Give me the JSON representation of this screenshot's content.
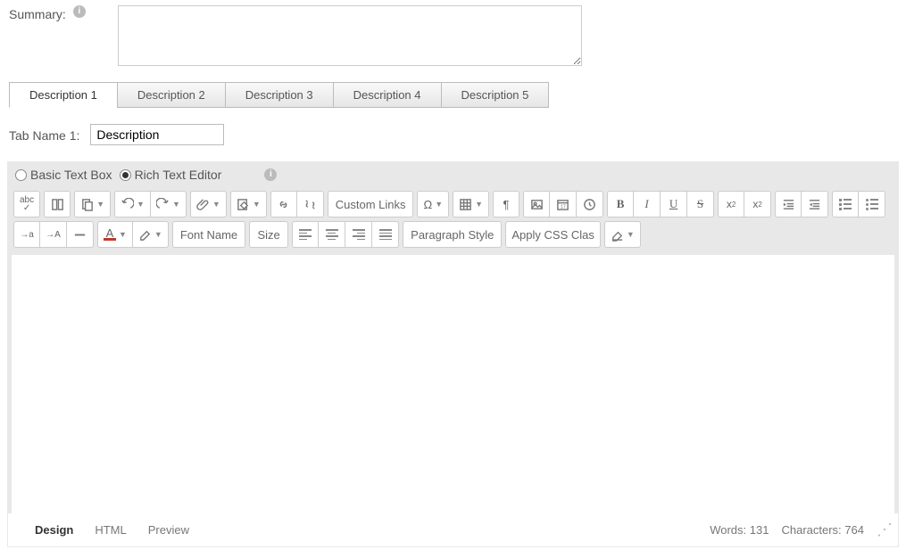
{
  "summary": {
    "label": "Summary:",
    "value": ""
  },
  "tabs": [
    {
      "label": "Description 1",
      "active": true
    },
    {
      "label": "Description 2",
      "active": false
    },
    {
      "label": "Description 3",
      "active": false
    },
    {
      "label": "Description 4",
      "active": false
    },
    {
      "label": "Description 5",
      "active": false
    }
  ],
  "tabName": {
    "label": "Tab Name 1:",
    "value": "Description"
  },
  "editorMode": {
    "basic": {
      "label": "Basic Text Box",
      "selected": false
    },
    "rich": {
      "label": "Rich Text Editor",
      "selected": true
    }
  },
  "toolbar": {
    "customLinks": "Custom Links",
    "fontName": "Font Name",
    "size": "Size",
    "paragraphStyle": "Paragraph Style",
    "applyCssClass": "Apply CSS Clas"
  },
  "footer": {
    "views": {
      "design": "Design",
      "html": "HTML",
      "preview": "Preview"
    },
    "wordsLabel": "Words:",
    "wordsCount": "131",
    "charsLabel": "Characters:",
    "charsCount": "764"
  }
}
